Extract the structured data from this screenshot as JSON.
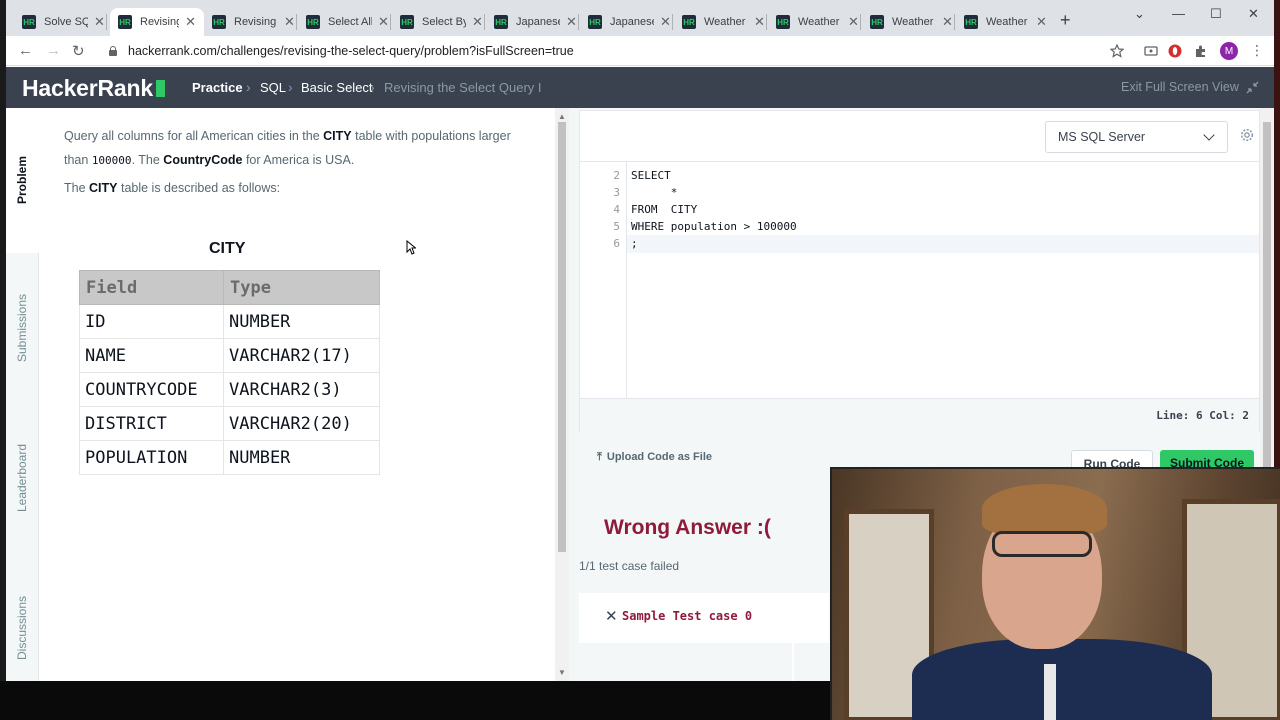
{
  "browser": {
    "tabs": [
      {
        "label": "Solve SQL"
      },
      {
        "label": "Revising"
      },
      {
        "label": "Revising"
      },
      {
        "label": "Select All"
      },
      {
        "label": "Select By"
      },
      {
        "label": "Japanese"
      },
      {
        "label": "Japanese"
      },
      {
        "label": "Weather"
      },
      {
        "label": "Weather"
      },
      {
        "label": "Weather"
      },
      {
        "label": "Weather"
      }
    ],
    "active_tab_index": 1,
    "url": "hackerrank.com/challenges/revising-the-select-query/problem?isFullScreen=true",
    "profile_initial": "M"
  },
  "header": {
    "logo": "HackerRank",
    "breadcrumb": [
      "Practice",
      "SQL",
      "Basic Select",
      "Revising the Select Query I"
    ],
    "exit_fullscreen": "Exit Full Screen View"
  },
  "sidenav": {
    "tabs": [
      "Problem",
      "Submissions",
      "Leaderboard",
      "Discussions"
    ],
    "active": "Problem"
  },
  "problem": {
    "line1_pre": "Query all columns for all American cities in the ",
    "line1_bold": "CITY",
    "line1_post": " table with populations larger",
    "line2_pre": "than ",
    "line2_code": "100000",
    "line2_mid": ". The ",
    "line2_bold": "CountryCode",
    "line2_post": " for America is ",
    "line2_code2": "USA",
    "line2_end": ".",
    "line3_pre": "The ",
    "line3_bold": "CITY",
    "line3_post": " table is described as follows:",
    "table_caption": "CITY",
    "table_headers": [
      "Field",
      "Type"
    ],
    "table_rows": [
      [
        "ID",
        "NUMBER"
      ],
      [
        "NAME",
        "VARCHAR2(17)"
      ],
      [
        "COUNTRYCODE",
        "VARCHAR2(3)"
      ],
      [
        "DISTRICT",
        "VARCHAR2(20)"
      ],
      [
        "POPULATION",
        "NUMBER"
      ]
    ]
  },
  "editor": {
    "language": "MS SQL Server",
    "line_numbers": [
      "2",
      "3",
      "4",
      "5",
      "6"
    ],
    "lines": [
      "SELECT",
      "      *",
      "FROM  CITY",
      "WHERE population > 100000",
      ";"
    ],
    "status": "Line: 6 Col: 2",
    "upload_label": "Upload Code as File",
    "run_label": "Run Code",
    "submit_label": "Submit Code"
  },
  "result": {
    "verdict": "Wrong Answer :(",
    "summary": "1/1 test case failed",
    "test_case": "Sample Test case 0"
  },
  "colors": {
    "hr_header": "#39424e",
    "hr_green": "#2ec866",
    "wrong_answer": "#8e1b3b"
  }
}
